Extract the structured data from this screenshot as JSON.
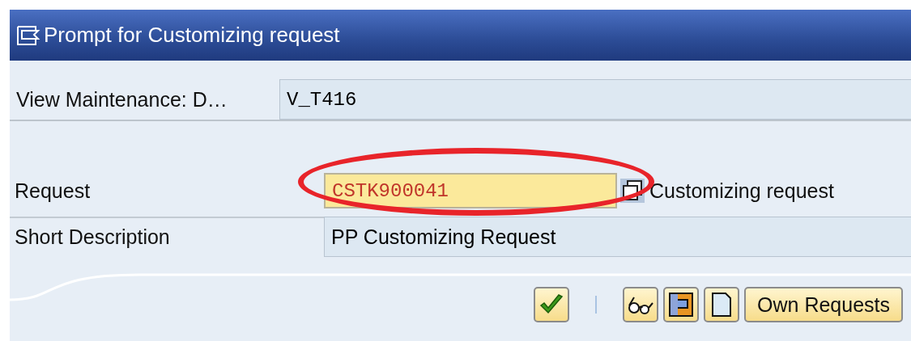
{
  "window": {
    "title": "Prompt for Customizing request"
  },
  "fields": [
    {
      "kind": "display",
      "label": "View Maintenance: D…",
      "value": "V_T416"
    },
    {
      "kind": "input",
      "label": "Request",
      "value": "CSTK900041",
      "description": "Customizing request"
    },
    {
      "kind": "display",
      "label": "Short Description",
      "value": "PP Customizing Request"
    }
  ],
  "toolbar": {
    "own_requests": "Own Requests"
  }
}
